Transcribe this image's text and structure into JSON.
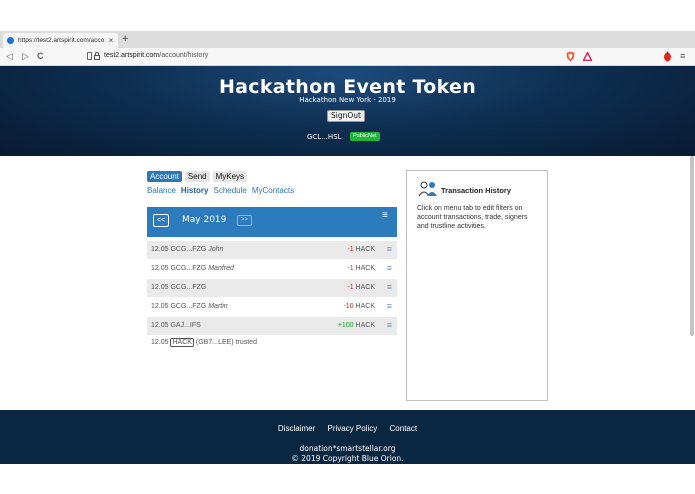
{
  "browser": {
    "tab_title": "https://test2.artspirit.com/acco",
    "tab_close": "×",
    "new_tab": "+",
    "url_host": "test2.artspirit.com",
    "url_path": "/account/history",
    "back": "◁",
    "forward": "▷",
    "reload": "C",
    "menu": "≡"
  },
  "header": {
    "title": "Hackathon Event Token",
    "subtitle": "Hackathon New York - 2019",
    "signout_label": "SignOut",
    "account": "GCL...HSL",
    "network_badge": "PublicNet"
  },
  "nav": {
    "tabs": [
      {
        "label": "Account",
        "active": true
      },
      {
        "label": "Send",
        "active": false
      },
      {
        "label": "MyKeys",
        "active": false
      }
    ],
    "links": [
      {
        "label": "Balance",
        "active": false
      },
      {
        "label": "History",
        "active": true
      },
      {
        "label": "Schedule",
        "active": false
      },
      {
        "label": "MyContacts",
        "active": false
      }
    ]
  },
  "history": {
    "prev_label": "<<",
    "month": "May 2019",
    "next_label": ">>",
    "menu_glyph": "≡",
    "rows": [
      {
        "date": "12.05",
        "addr": "GCG...FZG",
        "name": "John",
        "amount": "-1",
        "asset": "HACK",
        "sign": "neg"
      },
      {
        "date": "12.05",
        "addr": "GCG...FZG",
        "name": "Manfred",
        "amount": "-1",
        "asset": "HACK",
        "sign": "neg"
      },
      {
        "date": "12.05",
        "addr": "GCG...FZG",
        "name": "",
        "amount": "-1",
        "asset": "HACK",
        "sign": "neg"
      },
      {
        "date": "12.05",
        "addr": "GCG...FZG",
        "name": "Martin",
        "amount": "-10",
        "asset": "HACK",
        "sign": "neg"
      },
      {
        "date": "12.05",
        "addr": "GAJ...IFS",
        "name": "",
        "amount": "+100",
        "asset": "HACK",
        "sign": "pos"
      }
    ],
    "trust": {
      "date": "12.05",
      "asset": "HACK",
      "issuer": "(GB7...LEE) trusted"
    }
  },
  "info": {
    "title": "Transaction History",
    "text": "Click on menu tab to edit filters on account transactions, trade, signers and trustline activities."
  },
  "footer": {
    "links": [
      "Disclaimer",
      "Privacy Policy",
      "Contact"
    ],
    "email": "donation*smartstellar.org",
    "copyright": "© 2019 Copyright Blue Orion."
  },
  "colors": {
    "accent": "#2b7bbd",
    "header_dark": "#0e2f52",
    "footer": "#0a2741",
    "negative": "#d62020",
    "positive": "#16a028",
    "badge": "#1fb53a"
  }
}
